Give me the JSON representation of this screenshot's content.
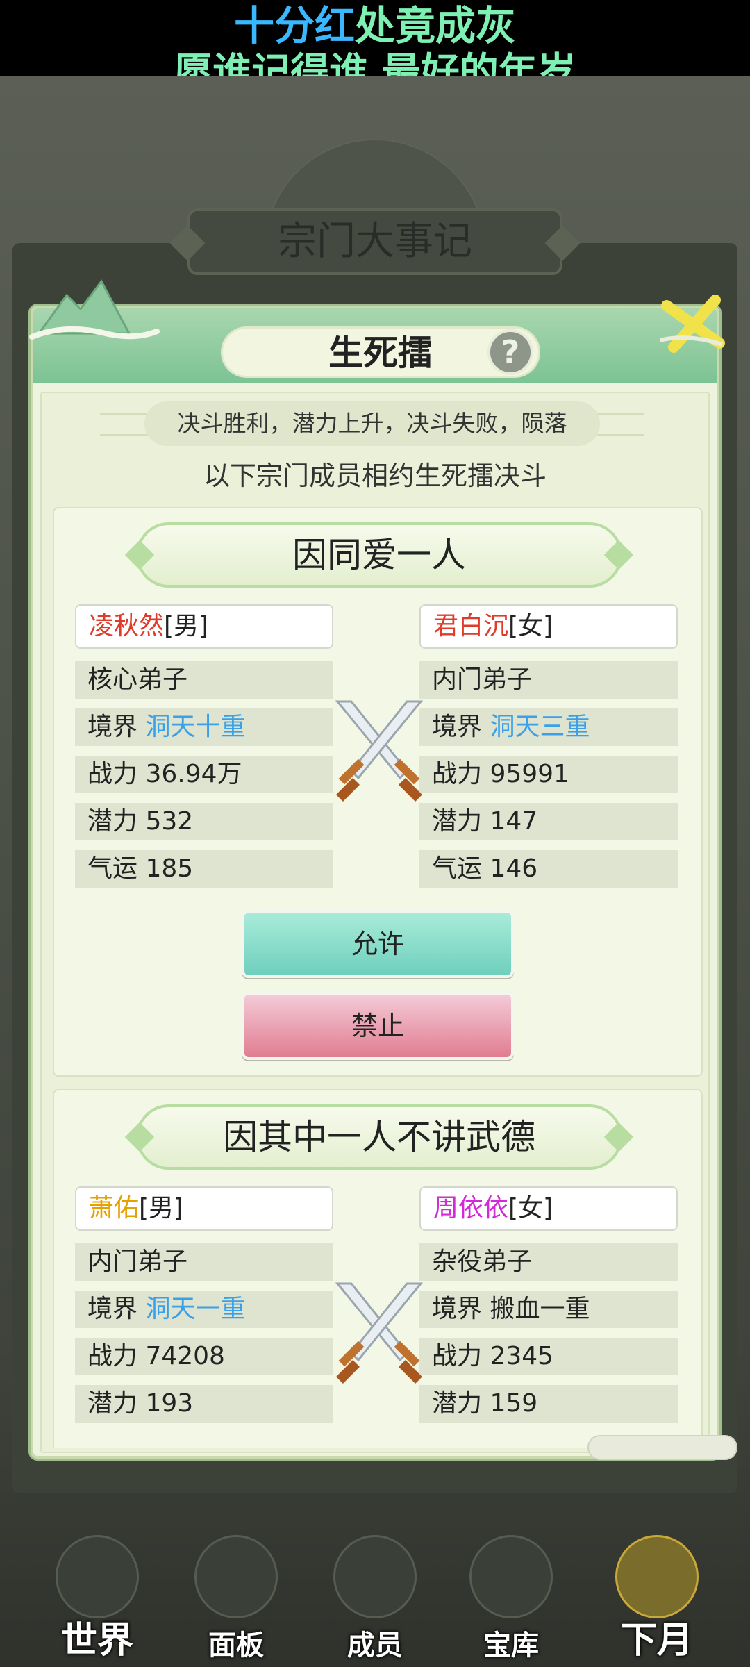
{
  "lyric": {
    "line1_part1": "十分红",
    "line1_part2": "处竟成灰",
    "line2": "愿谁记得谁 最好的年岁",
    "color_part1": "#3ab8ff",
    "color_part2": "#7ef0b4"
  },
  "background": {
    "event_banner": "宗门大事记"
  },
  "modal": {
    "title": "生死擂",
    "help_label": "?",
    "rule_text": "决斗胜利，潜力上升，决斗失败，陨落",
    "subtitle": "以下宗门成员相约生死擂决斗",
    "duels": [
      {
        "reason": "因同爱一人",
        "left": {
          "name": "凌秋然",
          "name_color": "#e03a2a",
          "gender": "[男]",
          "rank": "核心弟子",
          "realm_label": "境界",
          "realm": "洞天十重",
          "realm_color": "#3aa0e8",
          "power": "战力 36.94万",
          "potential": "潜力 532",
          "luck": "气运 185"
        },
        "right": {
          "name": "君白沉",
          "name_color": "#e03a2a",
          "gender": "[女]",
          "rank": "内门弟子",
          "realm_label": "境界",
          "realm": "洞天三重",
          "realm_color": "#3aa0e8",
          "power": "战力 95991",
          "potential": "潜力 147",
          "luck": "气运 146"
        },
        "allow_label": "允许",
        "deny_label": "禁止"
      },
      {
        "reason": "因其中一人不讲武德",
        "left": {
          "name": "萧佑",
          "name_color": "#e6a100",
          "gender": "[男]",
          "rank": "内门弟子",
          "realm_label": "境界",
          "realm": "洞天一重",
          "realm_color": "#3aa0e8",
          "power": "战力 74208",
          "potential": "潜力 193"
        },
        "right": {
          "name": "周依依",
          "name_color": "#d22ad8",
          "gender": "[女]",
          "rank": "杂役弟子",
          "realm_label": "境界",
          "realm": "搬血一重",
          "realm_color": "#222222",
          "power": "战力 2345",
          "potential": "潜力 159"
        }
      }
    ]
  },
  "nav": {
    "items": [
      {
        "label": "世界",
        "icon": "pagoda-icon"
      },
      {
        "label": "面板",
        "icon": "temple-icon"
      },
      {
        "label": "成员",
        "icon": "disciple-icon"
      },
      {
        "label": "宝库",
        "icon": "treasury-icon"
      },
      {
        "label": "下月",
        "icon": "moon-icon"
      }
    ]
  }
}
